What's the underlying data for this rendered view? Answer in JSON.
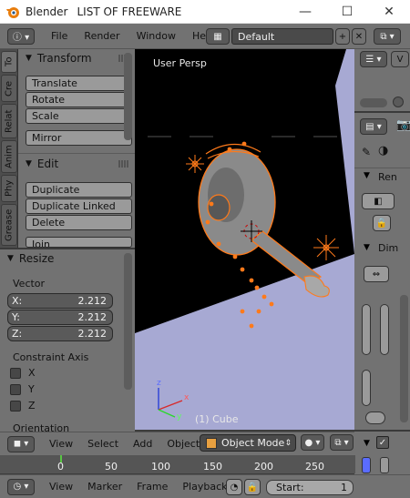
{
  "window": {
    "app_name": "Blender",
    "document_title": "LIST OF FREEWARE",
    "minimize": "—",
    "maximize": "☐",
    "close": "✕"
  },
  "menubar": {
    "items": [
      "File",
      "Render",
      "Window",
      "Help"
    ],
    "layout_name": "Default"
  },
  "toolshelf": {
    "tabs": [
      "To",
      "Cre",
      "Relat",
      "Anim",
      "Phy",
      "Grease"
    ],
    "transform": {
      "title": "Transform",
      "buttons": [
        "Translate",
        "Rotate",
        "Scale",
        "Mirror"
      ]
    },
    "edit": {
      "title": "Edit",
      "buttons": [
        "Duplicate",
        "Duplicate Linked",
        "Delete",
        "Join"
      ]
    }
  },
  "redo_panel": {
    "title": "Resize",
    "vector_label": "Vector",
    "vector": [
      {
        "axis": "X:",
        "value": "2.212"
      },
      {
        "axis": "Y:",
        "value": "2.212"
      },
      {
        "axis": "Z:",
        "value": "2.212"
      }
    ],
    "constraint_label": "Constraint Axis",
    "constraints": [
      "X",
      "Y",
      "Z"
    ],
    "orientation_label": "Orientation"
  },
  "viewport": {
    "view_name": "User Persp",
    "object_label": "(1) Cube",
    "axes": {
      "x": "x",
      "y": "y",
      "z": "z"
    }
  },
  "viewport_header": {
    "menus": [
      "View",
      "Select",
      "Add",
      "Object"
    ],
    "mode": "Object Mode"
  },
  "timeline": {
    "ticks": [
      "0",
      "50",
      "100",
      "150",
      "200",
      "250"
    ],
    "menus": [
      "View",
      "Marker",
      "Frame",
      "Playback"
    ],
    "start_label": "Start:",
    "start_value": "1"
  },
  "properties": {
    "panel_labels": [
      "Ren",
      "Dim"
    ]
  },
  "colors": {
    "ui_gray": "#727272",
    "selection_orange": "#ff7a1a",
    "floor_blue": "#a7a9d3"
  }
}
